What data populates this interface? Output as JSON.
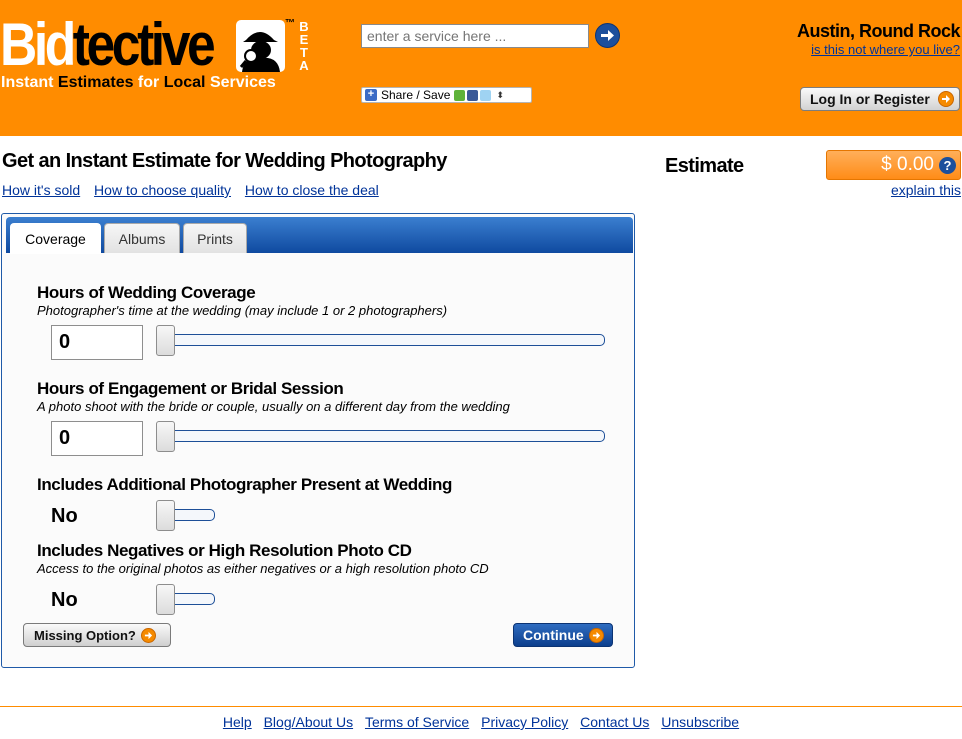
{
  "brand": {
    "name_part1": "Bid",
    "name_part2": "tective",
    "tm": "™",
    "beta": [
      "B",
      "E",
      "T",
      "A"
    ],
    "tagline_1": "Instant ",
    "tagline_2": "Estimates",
    "tagline_3": " for ",
    "tagline_4": "Local",
    "tagline_5": " Services",
    "colors": {
      "header": "#ff8c00",
      "link": "#003399",
      "primary": "#1c4f9c"
    }
  },
  "search": {
    "placeholder": "enter a service here ...",
    "go_icon": "arrow-right-icon"
  },
  "share": {
    "label": "Share / Save"
  },
  "location": {
    "name": "Austin, Round Rock",
    "change_link": "is this not where you live?"
  },
  "auth": {
    "login_label": "Log In or Register"
  },
  "page": {
    "title": "Get an Instant Estimate for Wedding Photography",
    "links": [
      "How it's sold",
      "How to choose quality",
      "How to close the deal"
    ]
  },
  "estimate": {
    "label": "Estimate",
    "value": "$ 0.00",
    "help": "?",
    "explain": "explain this"
  },
  "tabs": [
    {
      "label": "Coverage",
      "active": true
    },
    {
      "label": "Albums",
      "active": false
    },
    {
      "label": "Prints",
      "active": false
    }
  ],
  "questions": [
    {
      "title": "Hours of Wedding Coverage",
      "desc": "Photographer's time at the wedding (may include 1 or 2 photographers)",
      "value": "0"
    },
    {
      "title": "Hours of Engagement or Bridal Session",
      "desc": "A photo shoot with the bride or couple, usually on a different day from the wedding",
      "value": "0"
    },
    {
      "title": "Includes Additional Photographer Present at Wedding",
      "desc": "",
      "value": "No"
    },
    {
      "title": "Includes Negatives or High Resolution Photo CD",
      "desc": "Access to the original photos as either negatives or a high resolution photo CD",
      "value": "No"
    }
  ],
  "actions": {
    "missing_label": "Missing Option?",
    "continue_label": "Continue"
  },
  "footer": {
    "links": [
      "Help",
      "Blog/About Us",
      "Terms of Service",
      "Privacy Policy",
      "Contact Us",
      "Unsubscribe"
    ]
  }
}
